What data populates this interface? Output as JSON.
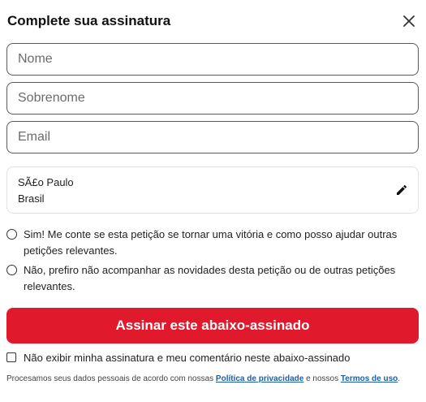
{
  "header": {
    "title": "Complete sua assinatura",
    "close_icon": "close-icon"
  },
  "form": {
    "first_name": {
      "placeholder": "Nome",
      "value": ""
    },
    "last_name": {
      "placeholder": "Sobrenome",
      "value": ""
    },
    "email": {
      "placeholder": "Email",
      "value": ""
    }
  },
  "location": {
    "city": "SÃ£o Paulo",
    "country": "Brasil",
    "edit_icon": "pencil-icon"
  },
  "consent": {
    "options": [
      {
        "label": "Sim! Me conte se esta petição se tornar uma vitória e como posso ajudar outras petições relevantes.",
        "selected": false
      },
      {
        "label": "Não, prefiro não acompanhar as novidades desta petição ou de outras petições relevantes.",
        "selected": false
      }
    ]
  },
  "submit": {
    "label": "Assinar este abaixo-assinado",
    "color": "#e1192d"
  },
  "hide_signature": {
    "label": "Não exibir minha assinatura e meu comentário neste abaixo-assinado",
    "checked": false
  },
  "privacy": {
    "prefix": "Procesamos seus dados pessoais de acordo com nossas",
    "policy_link": "Política de privacidade",
    "middle": "e nossos",
    "terms_link": "Termos de uso",
    "suffix": "."
  }
}
